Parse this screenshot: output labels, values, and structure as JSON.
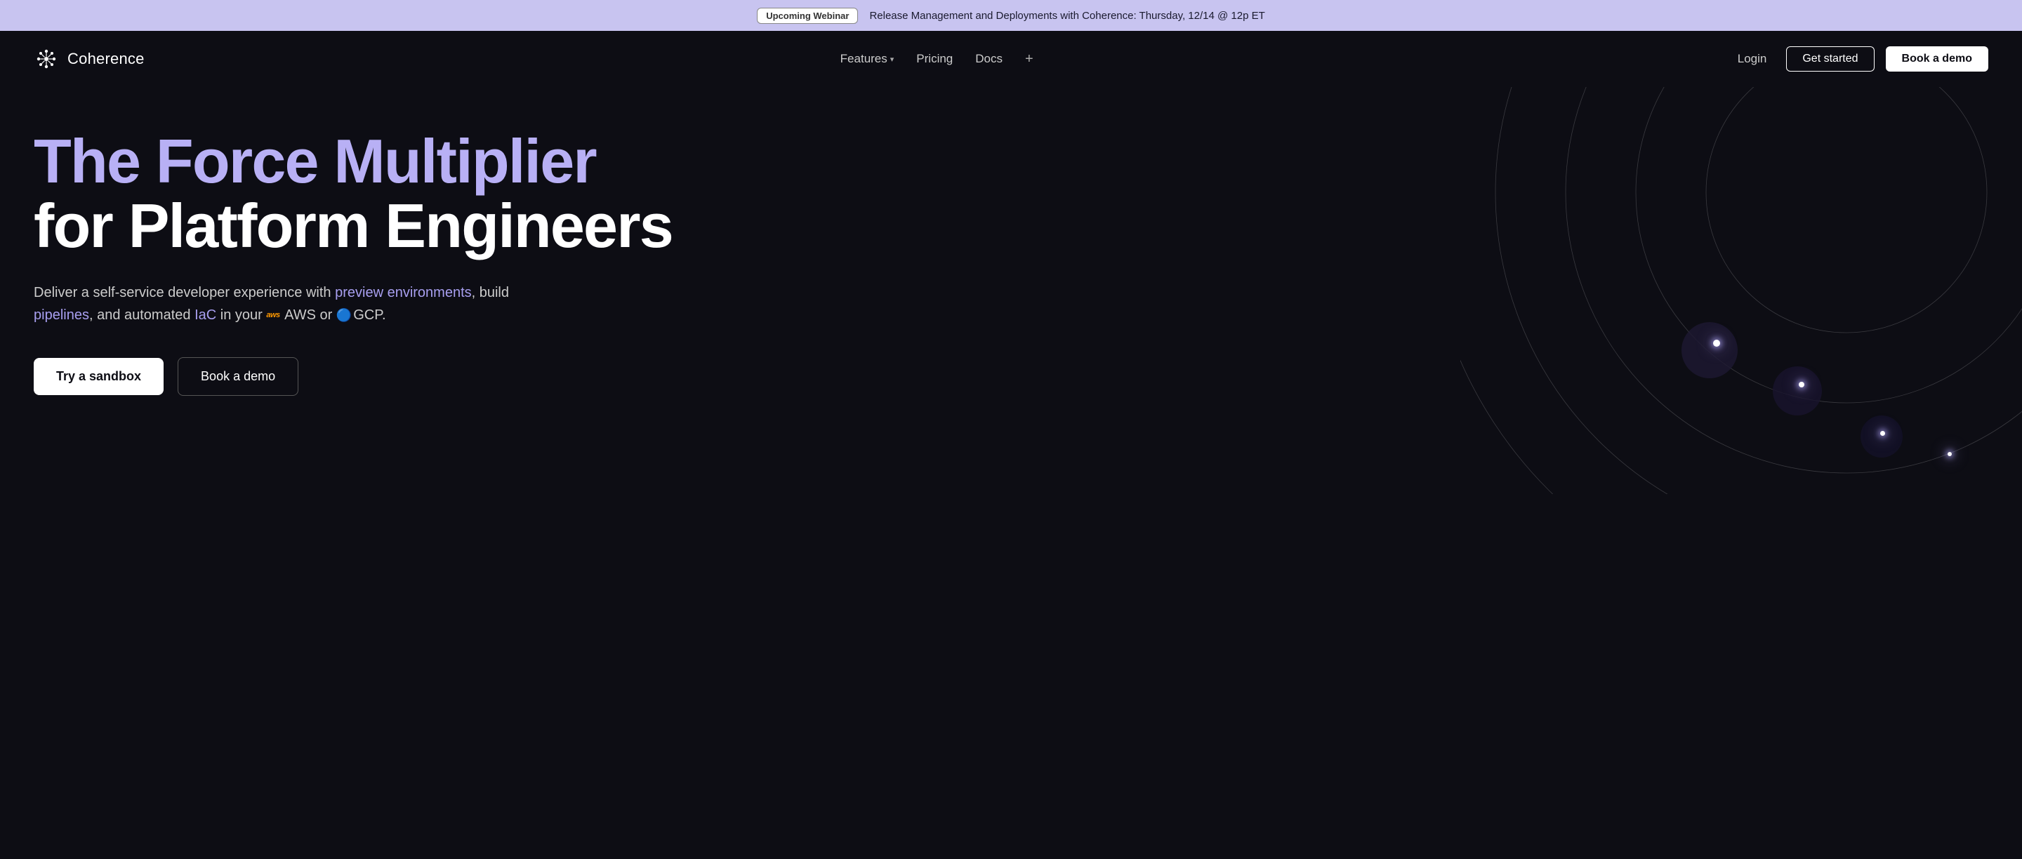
{
  "banner": {
    "badge_label": "Upcoming Webinar",
    "text": "Release Management and Deployments with Coherence: Thursday, 12/14 @ 12p ET"
  },
  "nav": {
    "logo_text": "Coherence",
    "links": [
      {
        "label": "Features",
        "has_dropdown": true
      },
      {
        "label": "Pricing",
        "has_dropdown": false
      },
      {
        "label": "Docs",
        "has_dropdown": false
      }
    ],
    "plus_icon": "+",
    "login_label": "Login",
    "get_started_label": "Get started",
    "book_demo_label": "Book a demo"
  },
  "hero": {
    "title_line1": "The Force Multiplier",
    "title_line2": "for Platform Engineers",
    "subtitle_plain_start": "Deliver a self-service developer experience with ",
    "subtitle_link1": "preview environments",
    "subtitle_plain_mid1": ", build ",
    "subtitle_link2": "pipelines",
    "subtitle_plain_mid2": ", and automated ",
    "subtitle_link3": "IaC",
    "subtitle_plain_end": " in your ",
    "aws_label": "AWS",
    "cloud_connector": " or ",
    "gcp_label": "GCP",
    "subtitle_end_dot": ".",
    "cta_sandbox": "Try a sandbox",
    "cta_demo": "Book a demo"
  },
  "colors": {
    "accent_purple": "#b8b0f5",
    "link_purple": "#a89ff0",
    "bg_dark": "#0d0d14",
    "banner_bg": "#c8c4f0",
    "white": "#ffffff"
  }
}
